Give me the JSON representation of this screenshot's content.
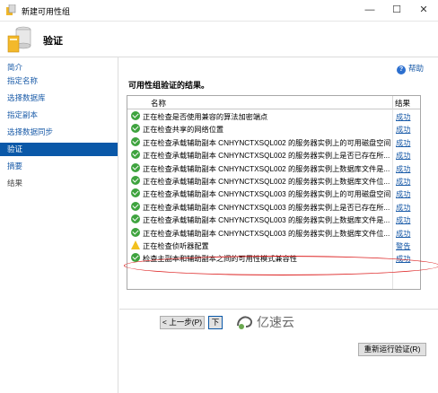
{
  "window": {
    "title": "新建可用性组",
    "minimize": "—",
    "maximize": "☐",
    "close": "✕"
  },
  "header": {
    "title": "验证"
  },
  "sidebar": {
    "items": [
      {
        "label": "简介"
      },
      {
        "label": "指定名称"
      },
      {
        "label": "选择数据库"
      },
      {
        "label": "指定副本"
      },
      {
        "label": "选择数据同步"
      },
      {
        "label": "验证"
      },
      {
        "label": "摘要"
      },
      {
        "label": "结果"
      }
    ]
  },
  "main": {
    "help_label": "帮助",
    "section_title": "可用性组验证的结果。",
    "columns": {
      "name": "名称",
      "result": "结果"
    },
    "rows": [
      {
        "status": "success",
        "name": "正在检查是否使用兼容的算法加密端点",
        "result": "成功"
      },
      {
        "status": "success",
        "name": "正在检查共享的网络位置",
        "result": "成功"
      },
      {
        "status": "success",
        "name": "正在检查承载辅助副本 CNHYNCTXSQL002 的服务器实例上的可用磁盘空间",
        "result": "成功"
      },
      {
        "status": "success",
        "name": "正在检查承载辅助副本 CNHYNCTXSQL002 的服务器实例上是否已存在所...",
        "result": "成功"
      },
      {
        "status": "success",
        "name": "正在检查承载辅助副本 CNHYNCTXSQL002 的服务器实例上数据库文件是...",
        "result": "成功"
      },
      {
        "status": "success",
        "name": "正在检查承载辅助副本 CNHYNCTXSQL002 的服务器实例上数据库文件位...",
        "result": "成功"
      },
      {
        "status": "success",
        "name": "正在检查承载辅助副本 CNHYNCTXSQL003 的服务器实例上的可用磁盘空间",
        "result": "成功"
      },
      {
        "status": "success",
        "name": "正在检查承载辅助副本 CNHYNCTXSQL003 的服务器实例上是否已存在所...",
        "result": "成功"
      },
      {
        "status": "success",
        "name": "正在检查承载辅助副本 CNHYNCTXSQL003 的服务器实例上数据库文件是...",
        "result": "成功"
      },
      {
        "status": "success",
        "name": "正在检查承载辅助副本 CNHYNCTXSQL003 的服务器实例上数据库文件位...",
        "result": "成功"
      },
      {
        "status": "warning",
        "name": "正在检查侦听器配置",
        "result": "警告"
      },
      {
        "status": "success",
        "name": "检查主副本和辅助副本之间的可用性模式兼容性",
        "result": "成功"
      }
    ],
    "rerun_label": "重新运行验证(R)",
    "prev_label": "< 上一步(P)",
    "next_label": "下",
    "watermark": "亿速云"
  }
}
